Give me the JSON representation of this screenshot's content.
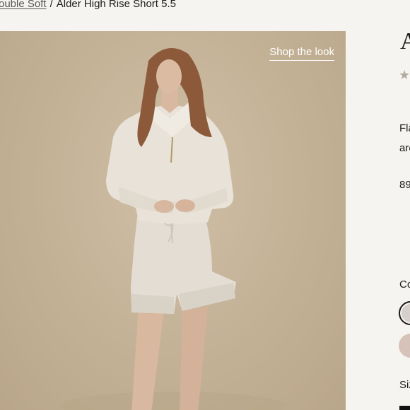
{
  "breadcrumb": {
    "parent": "ouble Soft",
    "separator": "/",
    "current": "Alder High Rise Short 5.5"
  },
  "hero": {
    "shop_the_look": "Shop the look",
    "background_color": "#c5b398"
  },
  "product_info": {
    "title_fragment": "A",
    "rating_icon": "star-icon",
    "description_line1": "Fla",
    "description_line2": "are",
    "price_fragment": "89",
    "color_label": "Co",
    "swatches": [
      {
        "name": "oatmeal",
        "color": "#d7cfc9",
        "selected": true
      },
      {
        "name": "blush",
        "color": "#d6c2b8",
        "selected": false
      }
    ],
    "size_label": "Siz"
  }
}
